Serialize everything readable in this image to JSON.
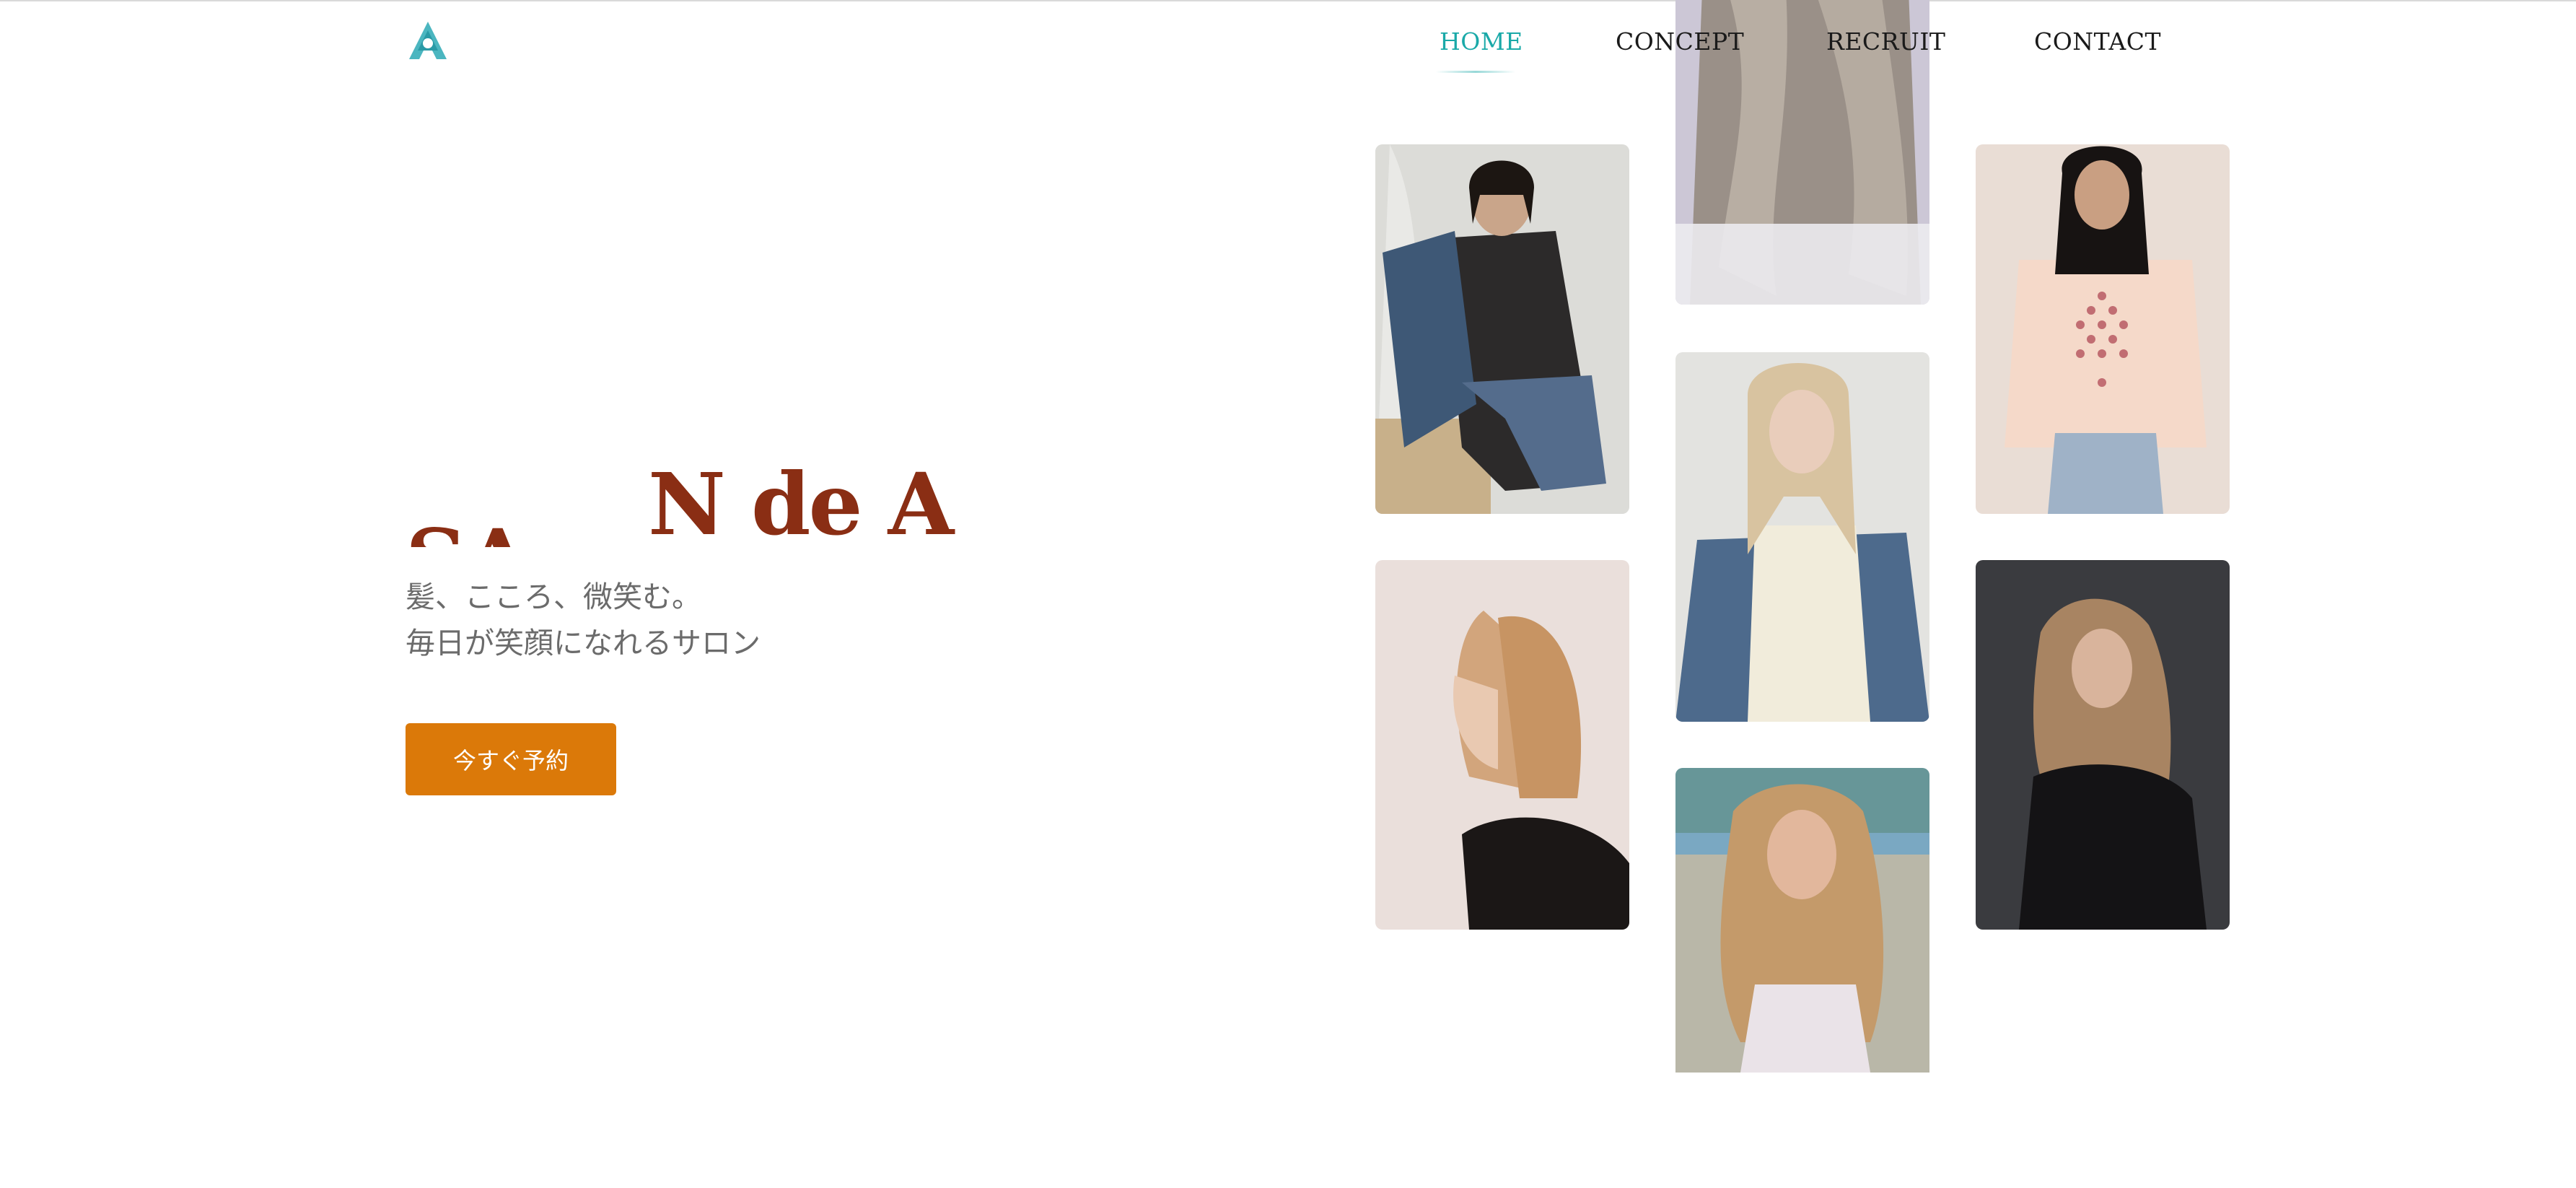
{
  "brand": {
    "logo_icon": "triangle-a-logo-icon",
    "accent": "#1aa9a8"
  },
  "nav": {
    "items": [
      {
        "label": "HOME",
        "active": true
      },
      {
        "label": "CONCEPT",
        "active": false
      },
      {
        "label": "RECRUIT",
        "active": false
      },
      {
        "label": "CONTACT",
        "active": false
      }
    ]
  },
  "hero": {
    "title_part1": "SA",
    "title_part2": "N de A",
    "title_color": "#8a2e14",
    "tagline_line1": "髪、こころ、微笑む。",
    "tagline_line2": "毎日が笑顔になれるサロン",
    "cta_label": "今すぐ予約",
    "cta_color": "#db7909"
  },
  "gallery": {
    "photos": [
      {
        "name": "model-photo-1"
      },
      {
        "name": "model-photo-2"
      },
      {
        "name": "model-photo-3"
      },
      {
        "name": "model-photo-4"
      },
      {
        "name": "model-photo-5"
      },
      {
        "name": "model-photo-6"
      },
      {
        "name": "model-photo-7"
      }
    ]
  }
}
